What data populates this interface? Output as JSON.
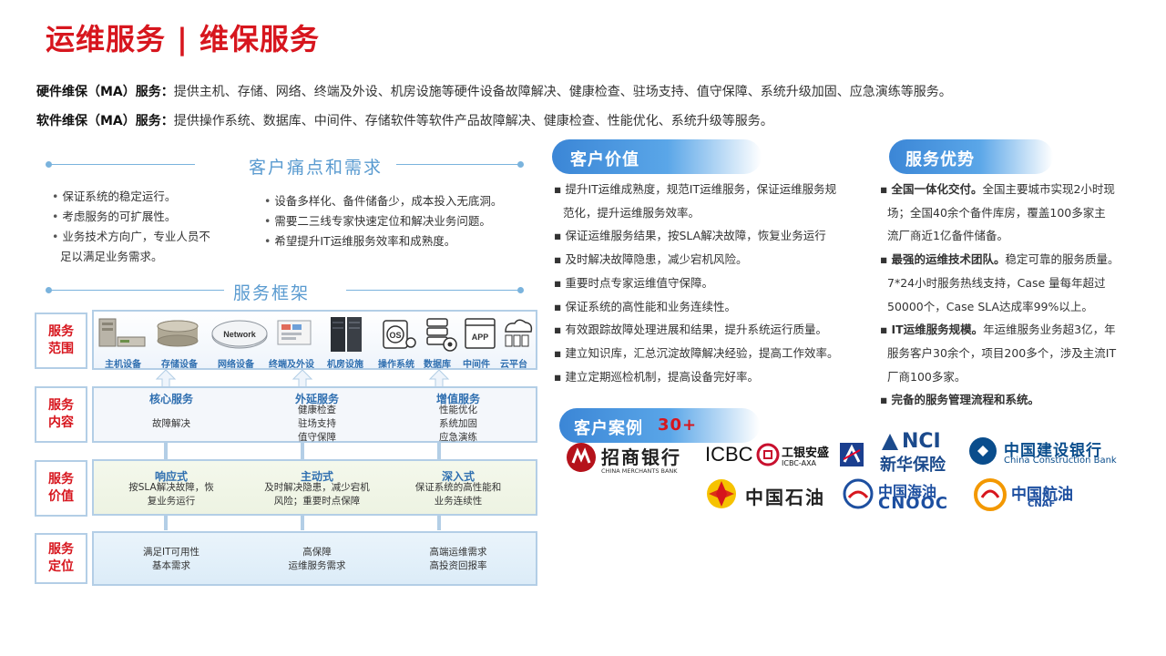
{
  "page": {
    "title": "运维服务 | 维保服务",
    "intro": [
      {
        "label": "硬件维保（MA）服务：",
        "text": "提供主机、存储、网络、终端及外设、机房设施等硬件设备故障解决、健康检查、驻场支持、值守保障、系统升级加固、应急演练等服务。"
      },
      {
        "label": "软件维保（MA）服务：",
        "text": "提供操作系统、数据库、中间件、存储软件等软件产品故障解决、健康检查、性能优化、系统升级等服务。"
      }
    ]
  },
  "pain": {
    "title": "客户痛点和需求",
    "left": [
      "保证系统的稳定运行。",
      "考虑服务的可扩展性。",
      "业务技术方向广，专业人员不",
      "足以满足业务需求。"
    ],
    "right": [
      "设备多样化、备件储备少，成本投入无底洞。",
      "需要二三线专家快速定位和解决业务问题。",
      "希望提升IT运维服务效率和成熟度。"
    ]
  },
  "framework": {
    "title": "服务框架",
    "row_labels": [
      {
        "l1": "服务",
        "l2": "范围"
      },
      {
        "l1": "服务",
        "l2": "内容"
      },
      {
        "l1": "服务",
        "l2": "价值"
      },
      {
        "l1": "服务",
        "l2": "定位"
      }
    ],
    "scope_items": [
      {
        "label": "主机设备",
        "icon": "server-host-icon"
      },
      {
        "label": "存储设备",
        "icon": "storage-disk-icon"
      },
      {
        "label": "网络设备",
        "icon": "network-icon",
        "badge": "Network"
      },
      {
        "label": "终端及外设",
        "icon": "terminal-icon"
      },
      {
        "label": "机房设施",
        "icon": "server-rack-icon"
      },
      {
        "label": "操作系统",
        "icon": "os-icon",
        "badge": "OS"
      },
      {
        "label": "数据库",
        "icon": "database-icon"
      },
      {
        "label": "中间件",
        "icon": "middleware-app-icon",
        "badge": "APP"
      },
      {
        "label": "云平台",
        "icon": "cloud-platform-icon"
      }
    ],
    "content": [
      {
        "head": "核心服务",
        "lines": [
          "故障解决"
        ]
      },
      {
        "head": "外延服务",
        "lines": [
          "健康检查",
          "驻场支持",
          "值守保障"
        ]
      },
      {
        "head": "增值服务",
        "lines": [
          "性能优化",
          "系统加固",
          "应急演练"
        ]
      }
    ],
    "value": [
      {
        "head": "响应式",
        "lines": [
          "按SLA解决故障，恢",
          "复业务运行"
        ]
      },
      {
        "head": "主动式",
        "lines": [
          "及时解决隐患，减少宕机",
          "风险；重要时点保障"
        ]
      },
      {
        "head": "深入式",
        "lines": [
          "保证系统的高性能和",
          "业务连续性"
        ]
      }
    ],
    "position": [
      {
        "lines": [
          "满足IT可用性",
          "基本需求"
        ]
      },
      {
        "lines": [
          "高保障",
          "运维服务需求"
        ]
      },
      {
        "lines": [
          "高端运维需求",
          "高投资回报率"
        ]
      }
    ]
  },
  "value": {
    "title": "客户价值",
    "items": [
      "提升IT运维成熟度，规范IT运维服务，保证运维服务规",
      "范化，提升运维服务效率。",
      "保证运维服务结果，按SLA解决故障，恢复业务运行",
      "及时解决故障隐患，减少宕机风险。",
      "重要时点专家运维值守保障。",
      "保证系统的高性能和业务连续性。",
      "有效跟踪故障处理进展和结果，提升系统运行质量。",
      "建立知识库，汇总沉淀故障解决经验，提高工作效率。",
      "建立定期巡检机制，提高设备完好率。"
    ]
  },
  "advantage": {
    "title": "服务优势",
    "items": [
      {
        "bold": "全国一体化交付。",
        "text": "全国主要城市实现2小时现"
      },
      {
        "bold": "",
        "text": "场；全国40余个备件库房，覆盖100多家主"
      },
      {
        "bold": "",
        "text": "流厂商近1亿备件储备。"
      },
      {
        "bold": "最强的运维技术团队。",
        "text": "稳定可靠的服务质量。"
      },
      {
        "bold": "",
        "text": "7*24小时服务热线支持，Case 量每年超过"
      },
      {
        "bold": "",
        "text": "50000个，Case SLA达成率99%以上。"
      },
      {
        "bold": "IT运维服务规模。",
        "text": "年运维服务业务超3亿，年"
      },
      {
        "bold": "",
        "text": "服务客户30余个，项目200多个，涉及主流IT"
      },
      {
        "bold": "",
        "text": "厂商100多家。"
      },
      {
        "bold": "完备的服务管理流程和系统。",
        "text": ""
      }
    ]
  },
  "cases": {
    "title": "客户案例",
    "count": "30+",
    "logos": [
      {
        "name": "招商银行",
        "sub": "CHINA MERCHANTS BANK",
        "color": "#b5121b"
      },
      {
        "name": "ICBC",
        "sub2": "工银安盛",
        "sub": "ICBC-AXA",
        "color": "#c8102e"
      },
      {
        "name": "NCI",
        "sub2": "新华保险",
        "color": "#1b4a8c"
      },
      {
        "name": "中国建设银行",
        "sub": "China Construction Bank",
        "color": "#0a4d8c"
      },
      {
        "name": "中国石油",
        "color": "#d6151c"
      },
      {
        "name": "中国海油",
        "sub": "CNOOC",
        "color": "#1d4fa0"
      },
      {
        "name": "中国航油",
        "sub": "CNAF",
        "color": "#1d4fa0"
      }
    ]
  }
}
